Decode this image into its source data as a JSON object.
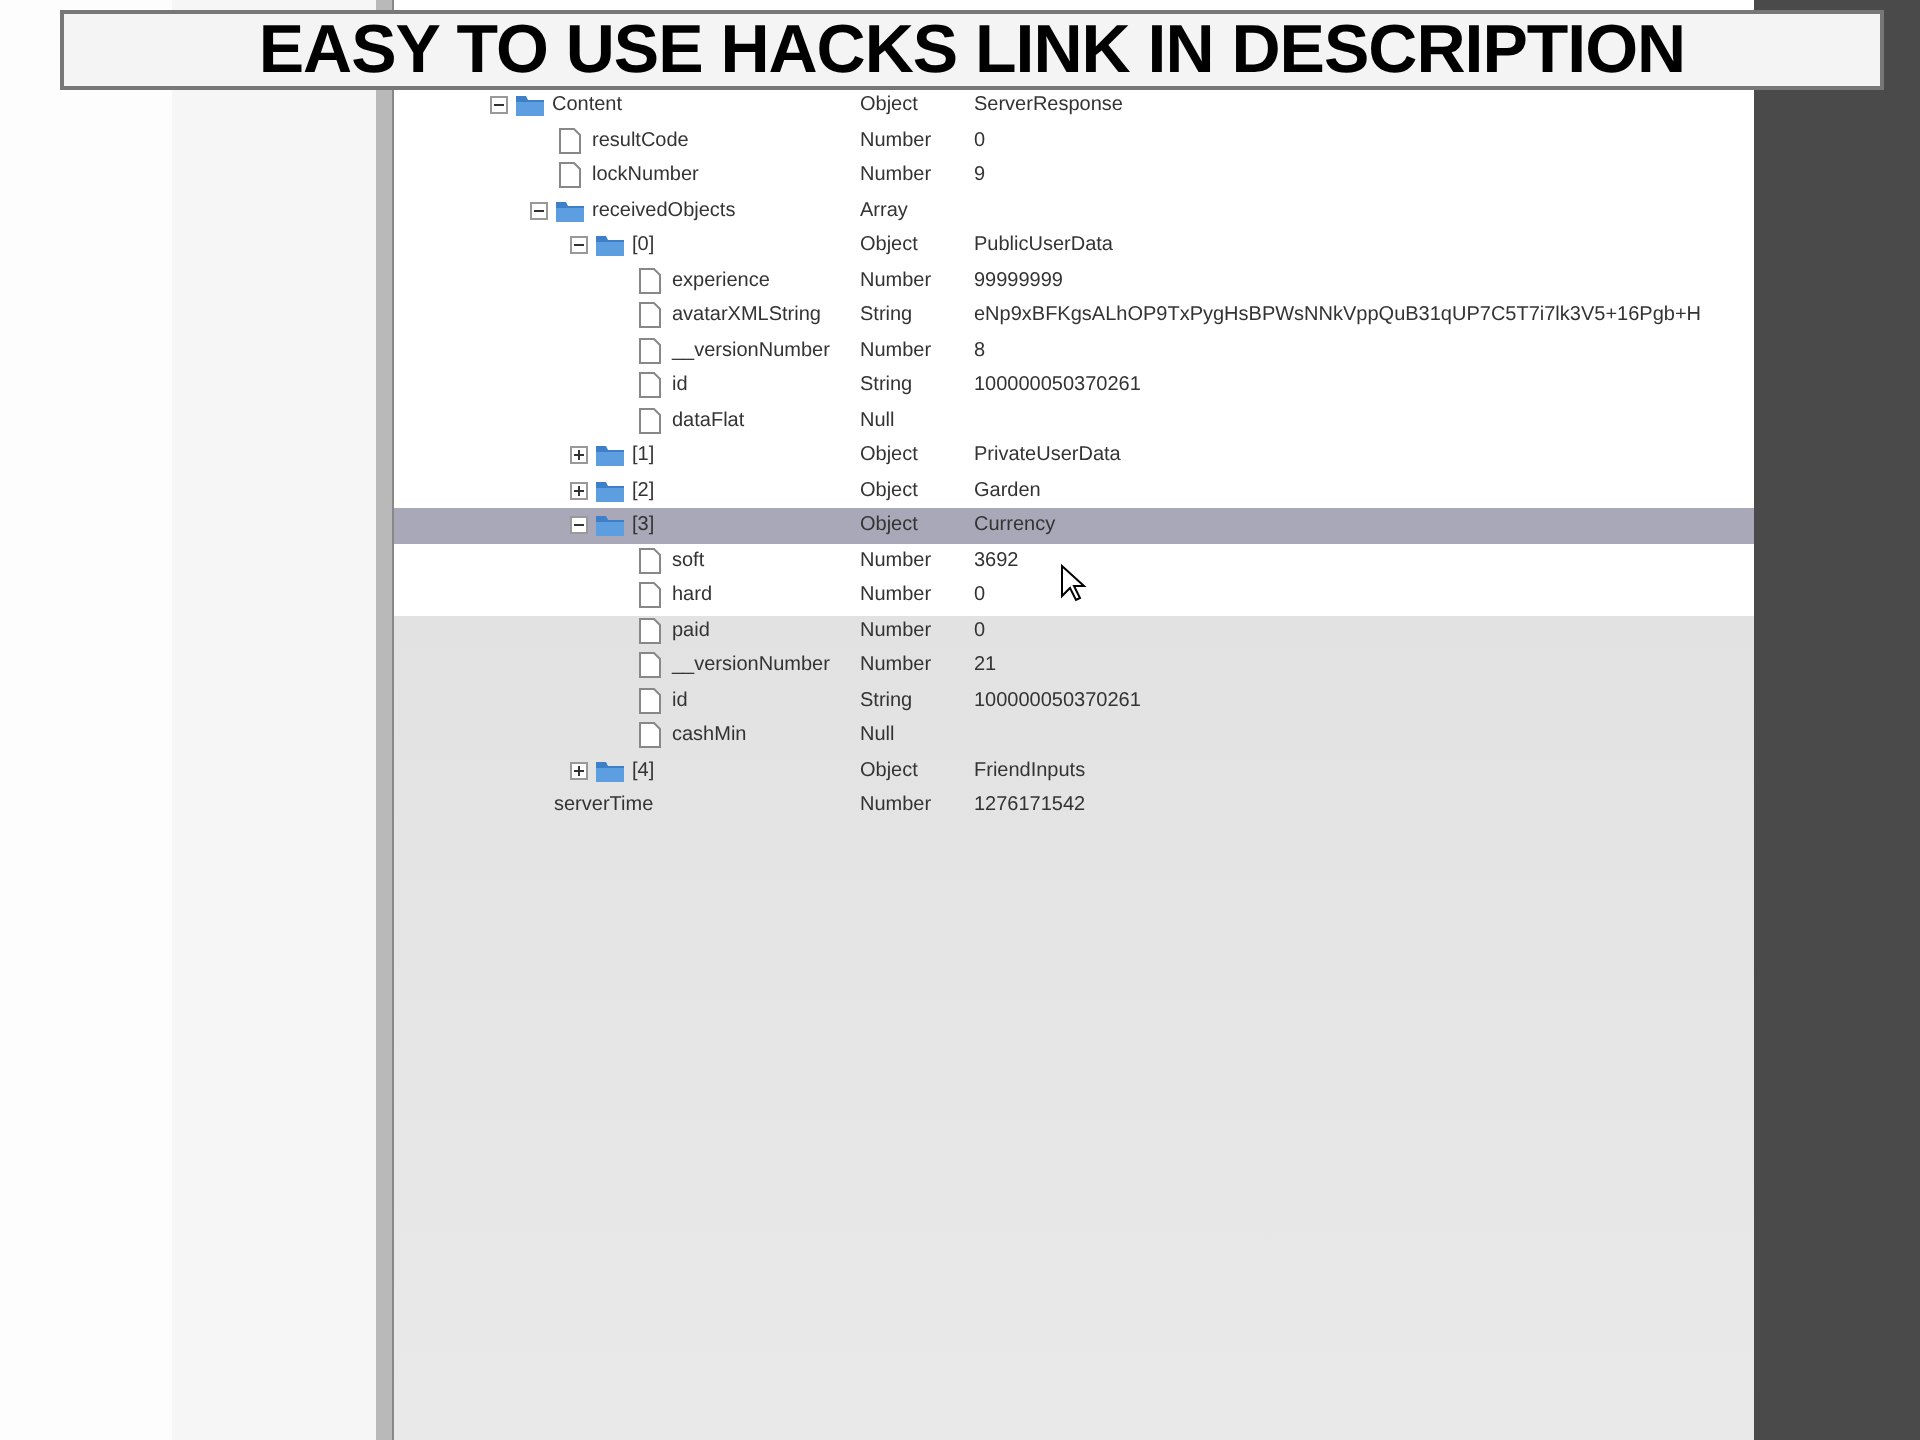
{
  "banner": {
    "text": "EASY TO USE HACKS LINK IN DESCRIPTION"
  },
  "tree": {
    "rows": [
      {
        "name": "Content",
        "type": "Object",
        "value": "ServerResponse",
        "kind": "folder",
        "expanded": true,
        "selected": false,
        "children": [
          {
            "name": "resultCode",
            "type": "Number",
            "value": "0",
            "kind": "leaf",
            "selected": false
          },
          {
            "name": "lockNumber",
            "type": "Number",
            "value": "9",
            "kind": "leaf",
            "selected": false
          },
          {
            "name": "receivedObjects",
            "type": "Array",
            "kind": "folder",
            "expanded": true,
            "selected": false,
            "children": [
              {
                "name": "[0]",
                "type": "Object",
                "value": "PublicUserData",
                "kind": "folder",
                "expanded": true,
                "selected": false,
                "children": [
                  {
                    "name": "experience",
                    "type": "Number",
                    "value": "99999999",
                    "kind": "leaf",
                    "selected": false
                  },
                  {
                    "name": "avatarXMLString",
                    "type": "String",
                    "value": "eNp9xBFKgsALhOP9TxPygHsBPWsNNkVppQuB31qUP7C5T7i7lk3V5+16Pgb+H",
                    "kind": "leaf",
                    "selected": false
                  },
                  {
                    "name": "__versionNumber",
                    "type": "Number",
                    "value": "8",
                    "kind": "leaf",
                    "selected": false
                  },
                  {
                    "name": "id",
                    "type": "String",
                    "value": "100000050370261",
                    "kind": "leaf",
                    "selected": false
                  },
                  {
                    "name": "dataFlat",
                    "type": "Null",
                    "kind": "leaf",
                    "selected": false
                  }
                ]
              },
              {
                "name": "[1]",
                "type": "Object",
                "value": "PrivateUserData",
                "kind": "folder",
                "expanded": false,
                "selected": false
              },
              {
                "name": "[2]",
                "type": "Object",
                "value": "Garden",
                "kind": "folder",
                "expanded": false,
                "selected": false
              },
              {
                "name": "[3]",
                "type": "Object",
                "value": "Currency",
                "kind": "folder",
                "expanded": true,
                "selected": true,
                "children": [
                  {
                    "name": "soft",
                    "type": "Number",
                    "value": "3692",
                    "kind": "leaf",
                    "selected": false
                  },
                  {
                    "name": "hard",
                    "type": "Number",
                    "value": "0",
                    "kind": "leaf",
                    "selected": false
                  },
                  {
                    "name": "paid",
                    "type": "Number",
                    "value": "0",
                    "kind": "leaf",
                    "selected": false
                  },
                  {
                    "name": "__versionNumber",
                    "type": "Number",
                    "value": "21",
                    "kind": "leaf",
                    "selected": false
                  },
                  {
                    "name": "id",
                    "type": "String",
                    "value": "100000050370261",
                    "kind": "leaf",
                    "selected": false
                  },
                  {
                    "name": "cashMin",
                    "type": "Null",
                    "kind": "leaf",
                    "selected": false
                  }
                ]
              },
              {
                "name": "[4]",
                "type": "Object",
                "value": "FriendInputs",
                "kind": "folder",
                "expanded": false,
                "selected": false
              }
            ]
          },
          {
            "name": "serverTime",
            "type": "Number",
            "value": "1276171542",
            "kind": "plain",
            "selected": false
          }
        ]
      }
    ]
  }
}
